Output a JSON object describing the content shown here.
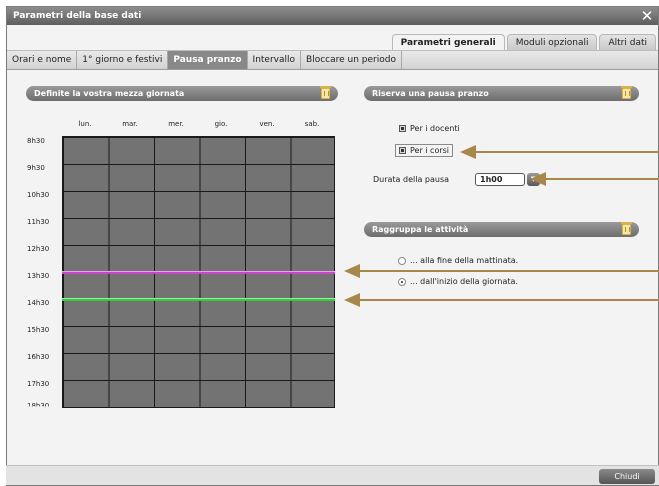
{
  "window": {
    "title": "Parametri della base dati",
    "close_glyph": "✕"
  },
  "top_tabs": [
    {
      "label": "Parametri generali",
      "active": true
    },
    {
      "label": "Moduli opzionali",
      "active": false
    },
    {
      "label": "Altri dati",
      "active": false
    }
  ],
  "sub_tabs": [
    {
      "label": "Orari e nome",
      "active": false
    },
    {
      "label": "1° giorno e festivi",
      "active": false
    },
    {
      "label": "Pausa pranzo",
      "active": true
    },
    {
      "label": "Intervallo",
      "active": false
    },
    {
      "label": "Bloccare un periodo",
      "active": false
    }
  ],
  "left_panel": {
    "title": "Definite la vostra mezza giornata",
    "days": [
      "lun.",
      "mar.",
      "mer.",
      "gio.",
      "ven.",
      "sab."
    ],
    "hours": [
      "8h30",
      "9h30",
      "10h30",
      "11h30",
      "12h30",
      "13h30",
      "14h30",
      "15h30",
      "16h30",
      "17h30",
      "18h30"
    ]
  },
  "reserve_panel": {
    "title": "Riserva una pausa pranzo",
    "options": [
      "Per i docenti",
      "Per i corsi"
    ],
    "duration_label": "Durata della pausa",
    "duration_value": "1h00"
  },
  "group_panel": {
    "title": "Raggruppa le attività",
    "options": [
      {
        "label": "... alla fine della mattinata.",
        "selected": false
      },
      {
        "label": "... dall'inizio della giornata.",
        "selected": true
      }
    ]
  },
  "footer": {
    "close_label": "Chiudi"
  },
  "colors": {
    "accent_arrow": "#a8884a",
    "magenta_line": "#cc44cc",
    "green_line": "#2fcf3a",
    "grid_cell": "#737373"
  },
  "icons": [
    "close-icon",
    "trash-icon",
    "chevron-down-icon",
    "pointer-arrow-icon"
  ]
}
